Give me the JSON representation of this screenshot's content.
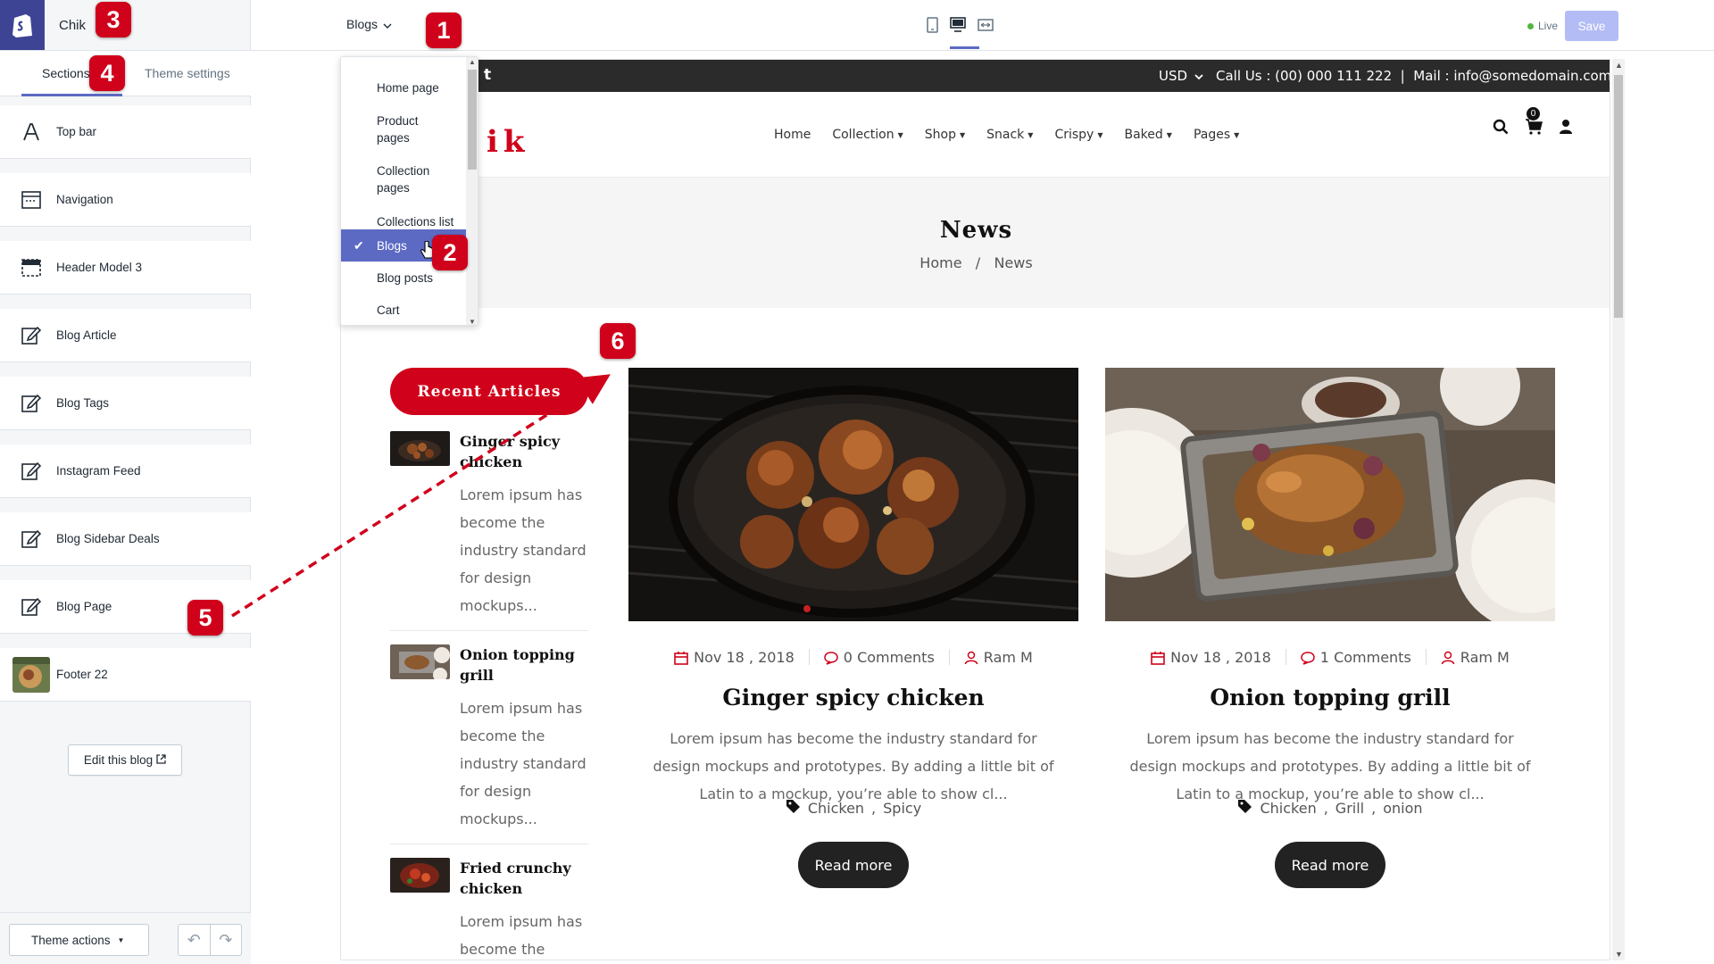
{
  "editor": {
    "store_name": "Chik",
    "tabs": {
      "sections": "Sections",
      "theme_settings": "Theme settings"
    },
    "sections": [
      {
        "label": "Top bar",
        "icon": "text-icon"
      },
      {
        "label": "Navigation",
        "icon": "navigation-icon"
      },
      {
        "label": "Header Model 3",
        "icon": "header-icon"
      },
      {
        "label": "Blog Article",
        "icon": "edit-icon"
      },
      {
        "label": "Blog Tags",
        "icon": "edit-icon"
      },
      {
        "label": "Instagram Feed",
        "icon": "edit-icon"
      },
      {
        "label": "Blog Sidebar Deals",
        "icon": "edit-icon"
      },
      {
        "label": "Blog Page",
        "icon": "edit-icon"
      },
      {
        "label": "Footer 22",
        "icon": "footer-thumbnail"
      }
    ],
    "edit_blog_label": "Edit this blog",
    "theme_actions_label": "Theme actions",
    "page_select_value": "Blogs",
    "live_label": "Live",
    "save_label": "Save",
    "accent_color": "#5c6ac4"
  },
  "dropdown": {
    "items": [
      {
        "label": "Home page",
        "selected": false
      },
      {
        "label": "Product pages",
        "selected": false
      },
      {
        "label": "Collection pages",
        "selected": false
      },
      {
        "label": "Collections list",
        "selected": false
      },
      {
        "label": "Blogs",
        "selected": true
      },
      {
        "label": "Blog posts",
        "selected": false
      },
      {
        "label": "Cart",
        "selected": false
      }
    ]
  },
  "store": {
    "social_glyph": "t",
    "currency": "USD",
    "contact": "Call Us : (00) 000 111 222  |  Mail : info@somedomain.com",
    "logo_text": "ik",
    "nav": [
      "Home",
      "Collection",
      "Shop",
      "Snack",
      "Crispy",
      "Baked",
      "Pages"
    ],
    "cart_count": "0",
    "banner_title": "News",
    "breadcrumb": "Home   /   News",
    "brand_color": "#d0021b",
    "sidebar_title": "Recent Articles",
    "recent_articles": [
      {
        "title": "Ginger spicy chicken",
        "excerpt": "Lorem ipsum has become the industry standard for design mockups..."
      },
      {
        "title": "Onion topping grill",
        "excerpt": "Lorem ipsum has become the industry standard for design mockups..."
      },
      {
        "title": "Fried crunchy chicken",
        "excerpt": "Lorem ipsum has become the"
      }
    ],
    "posts": [
      {
        "date": "Nov 18 , 2018",
        "comments": "0 Comments",
        "author": "Ram M",
        "title": "Ginger spicy chicken",
        "excerpt": "Lorem ipsum has become the industry standard for design mockups and prototypes. By adding a little bit of Latin to a mockup, you’re able to show cl...",
        "tags": [
          "Chicken",
          "Spicy"
        ],
        "read_more": "Read more"
      },
      {
        "date": "Nov 18 , 2018",
        "comments": "1 Comments",
        "author": "Ram M",
        "title": "Onion topping grill",
        "excerpt": "Lorem ipsum has become the industry standard for design mockups and prototypes. By adding a little bit of Latin to a mockup, you’re able to show cl...",
        "tags": [
          "Chicken",
          "Grill",
          "onion"
        ],
        "read_more": "Read more"
      }
    ]
  },
  "annotations": [
    "1",
    "2",
    "3",
    "4",
    "5",
    "6"
  ]
}
